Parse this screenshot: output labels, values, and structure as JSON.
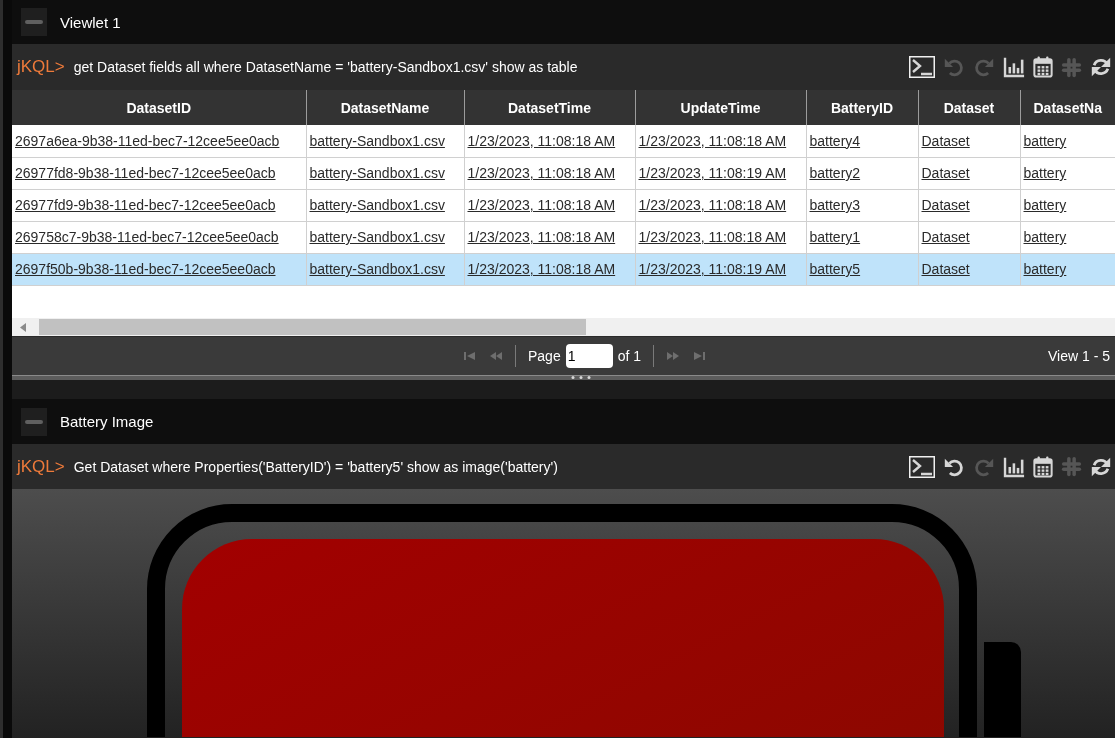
{
  "viewlets": [
    {
      "kind": "table",
      "title": "Viewlet 1",
      "prompt": "jKQL>",
      "query": "get Dataset fields all where DatasetName = 'battery-Sandbox1.csv' show as table",
      "toolbar": [
        {
          "kind": "terminal",
          "disabled": false
        },
        {
          "kind": "undo",
          "disabled": true
        },
        {
          "kind": "redo",
          "disabled": true
        },
        {
          "kind": "chart",
          "disabled": false
        },
        {
          "kind": "calendar",
          "disabled": false
        },
        {
          "kind": "hash",
          "disabled": true
        },
        {
          "kind": "refresh",
          "disabled": false
        }
      ],
      "table": {
        "columns": [
          "DatasetID",
          "DatasetName",
          "DatasetTime",
          "UpdateTime",
          "BatteryID",
          "Dataset",
          "DatasetNa"
        ],
        "rows": [
          {
            "selected": false,
            "cells": [
              "2697a6ea-9b38-11ed-bec7-12cee5ee0acb",
              "battery-Sandbox1.csv",
              "1/23/2023, 11:08:18 AM",
              "1/23/2023, 11:08:18 AM",
              "battery4",
              "Dataset",
              "battery"
            ]
          },
          {
            "selected": false,
            "cells": [
              "26977fd8-9b38-11ed-bec7-12cee5ee0acb",
              "battery-Sandbox1.csv",
              "1/23/2023, 11:08:18 AM",
              "1/23/2023, 11:08:19 AM",
              "battery2",
              "Dataset",
              "battery"
            ]
          },
          {
            "selected": false,
            "cells": [
              "26977fd9-9b38-11ed-bec7-12cee5ee0acb",
              "battery-Sandbox1.csv",
              "1/23/2023, 11:08:18 AM",
              "1/23/2023, 11:08:18 AM",
              "battery3",
              "Dataset",
              "battery"
            ]
          },
          {
            "selected": false,
            "cells": [
              "269758c7-9b38-11ed-bec7-12cee5ee0acb",
              "battery-Sandbox1.csv",
              "1/23/2023, 11:08:18 AM",
              "1/23/2023, 11:08:18 AM",
              "battery1",
              "Dataset",
              "battery"
            ]
          },
          {
            "selected": true,
            "cells": [
              "2697f50b-9b38-11ed-bec7-12cee5ee0acb",
              "battery-Sandbox1.csv",
              "1/23/2023, 11:08:18 AM",
              "1/23/2023, 11:08:19 AM",
              "battery5",
              "Dataset",
              "battery"
            ]
          }
        ]
      },
      "pager": {
        "nav": [
          {
            "kind": "first",
            "disabled": true
          },
          {
            "kind": "previous",
            "disabled": true
          },
          {
            "kind": "next",
            "disabled": true
          },
          {
            "kind": "last",
            "disabled": true
          }
        ],
        "page_label": "Page",
        "page": "1",
        "of_label": "of 1",
        "view_label": "View 1 - 5"
      }
    },
    {
      "kind": "image",
      "title": "Battery Image",
      "prompt": "jKQL>",
      "query": "Get Dataset where Properties('BatteryID') = 'battery5' show as image('battery')",
      "toolbar": [
        {
          "kind": "terminal",
          "disabled": false
        },
        {
          "kind": "undo",
          "disabled": false
        },
        {
          "kind": "redo",
          "disabled": true
        },
        {
          "kind": "chart",
          "disabled": false
        },
        {
          "kind": "calendar",
          "disabled": false
        },
        {
          "kind": "hash",
          "disabled": true
        },
        {
          "kind": "refresh",
          "disabled": false
        }
      ]
    }
  ]
}
